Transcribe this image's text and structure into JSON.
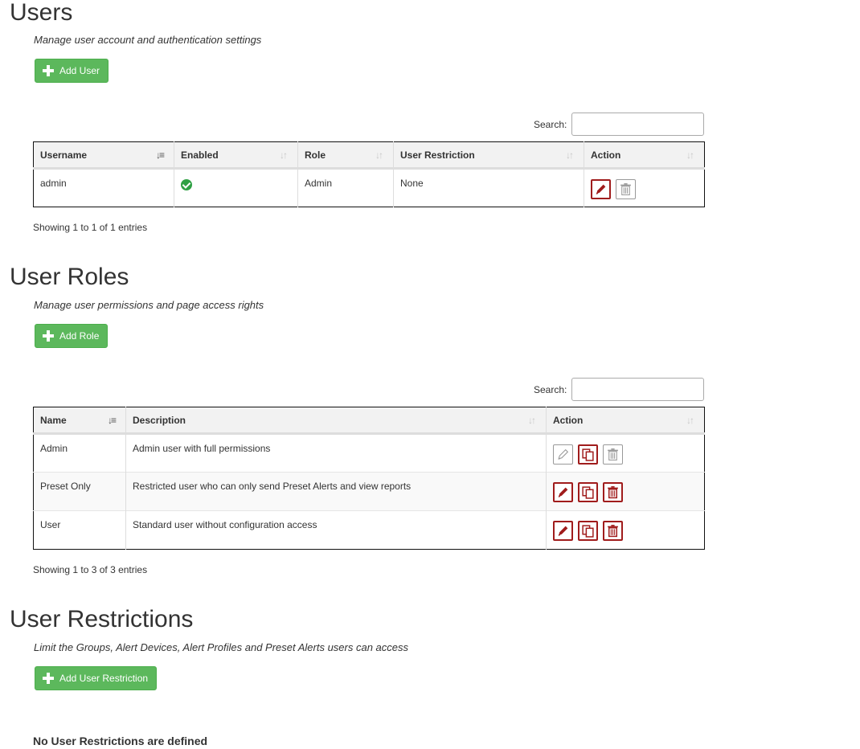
{
  "users": {
    "title": "Users",
    "description": "Manage user account and authentication settings",
    "add_label": "Add User",
    "search_label": "Search:",
    "search_value": "",
    "columns": [
      "Username",
      "Enabled",
      "Role",
      "User Restriction",
      "Action"
    ],
    "rows": [
      {
        "username": "admin",
        "enabled": true,
        "role": "Admin",
        "restriction": "None"
      }
    ],
    "info": "Showing 1 to 1 of 1 entries"
  },
  "roles": {
    "title": "User Roles",
    "description": "Manage user permissions and page access rights",
    "add_label": "Add Role",
    "search_label": "Search:",
    "search_value": "",
    "columns": [
      "Name",
      "Description",
      "Action"
    ],
    "rows": [
      {
        "name": "Admin",
        "description": "Admin user with full permissions",
        "editable": false,
        "deletable": false
      },
      {
        "name": "Preset Only",
        "description": "Restricted user who can only send Preset Alerts and view reports",
        "editable": true,
        "deletable": true
      },
      {
        "name": "User",
        "description": "Standard user without configuration access",
        "editable": true,
        "deletable": true
      }
    ],
    "info": "Showing 1 to 3 of 3 entries"
  },
  "restrictions": {
    "title": "User Restrictions",
    "description": "Limit the Groups, Alert Devices, Alert Profiles and Preset Alerts users can access",
    "add_label": "Add User Restriction",
    "empty_message": "No User Restrictions are defined"
  },
  "colors": {
    "add_button": "#5cb85c",
    "action_border": "#a01c1c",
    "enabled_check": "#2ea043"
  }
}
